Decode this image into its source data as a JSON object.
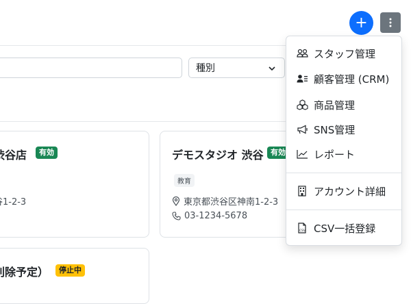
{
  "header": {
    "add_label": "+"
  },
  "filters": {
    "type_select": "種別"
  },
  "cards": [
    {
      "title": "渋谷店",
      "badge": "有効",
      "address": "谷1-2-3"
    },
    {
      "title": "デモスタジオ 渋谷",
      "badge": "有効",
      "tag": "教育",
      "address": "東京都渋谷区神南1-2-3",
      "phone": "03-1234-5678"
    },
    {
      "title": "削除予定）",
      "badge": "停止中"
    }
  ],
  "menu": {
    "items": [
      {
        "label": "スタッフ管理",
        "icon": "people-icon"
      },
      {
        "label": "顧客管理 (CRM)",
        "icon": "person-lines-icon"
      },
      {
        "label": "商品管理",
        "icon": "boxes-icon"
      },
      {
        "label": "SNS管理",
        "icon": "megaphone-icon"
      },
      {
        "label": "レポート",
        "icon": "graph-icon"
      },
      {
        "label": "アカウント詳細",
        "icon": "building-icon"
      },
      {
        "label": "CSV一括登録",
        "icon": "csv-file-icon"
      }
    ]
  },
  "colors": {
    "primary": "#0d6efd",
    "secondary": "#6c757d",
    "success": "#198754",
    "warning": "#ffc107"
  }
}
